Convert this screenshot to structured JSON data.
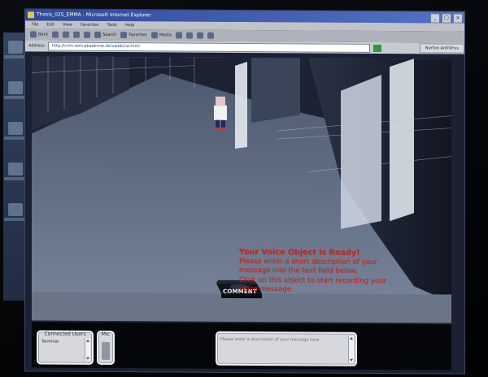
{
  "window": {
    "title": "Thesis_02S_EMMA - Microsoft Internet Explorer",
    "controls": [
      "_",
      "□",
      "×"
    ]
  },
  "menu": {
    "items": [
      "File",
      "Edit",
      "View",
      "Favorites",
      "Tools",
      "Help"
    ]
  },
  "toolbar": {
    "back_label": "Back",
    "search_label": "Search",
    "favorites_label": "Favorites",
    "media_label": "Media"
  },
  "address": {
    "label": "Address",
    "value": "http://cvm.iwm-akademie.de/cweb/cw.html",
    "links_label": "Norton AntiVirus"
  },
  "scene": {
    "comment_label": "COMMENT"
  },
  "message": {
    "heading": "Your Voice Object is Ready!",
    "lines": [
      "Please enter a short description of your",
      "message into the text field below.",
      "Click on this object to start recording your",
      "voice message."
    ]
  },
  "panels": {
    "connected_users": {
      "title": "Connected Users",
      "users": [
        "Terminal"
      ]
    },
    "mic": {
      "title": "Mic"
    },
    "description": {
      "placeholder": "Please enter a description of your message here"
    }
  },
  "colors": {
    "message_red": "#c1261b",
    "scene_floor": "#6a7688"
  }
}
